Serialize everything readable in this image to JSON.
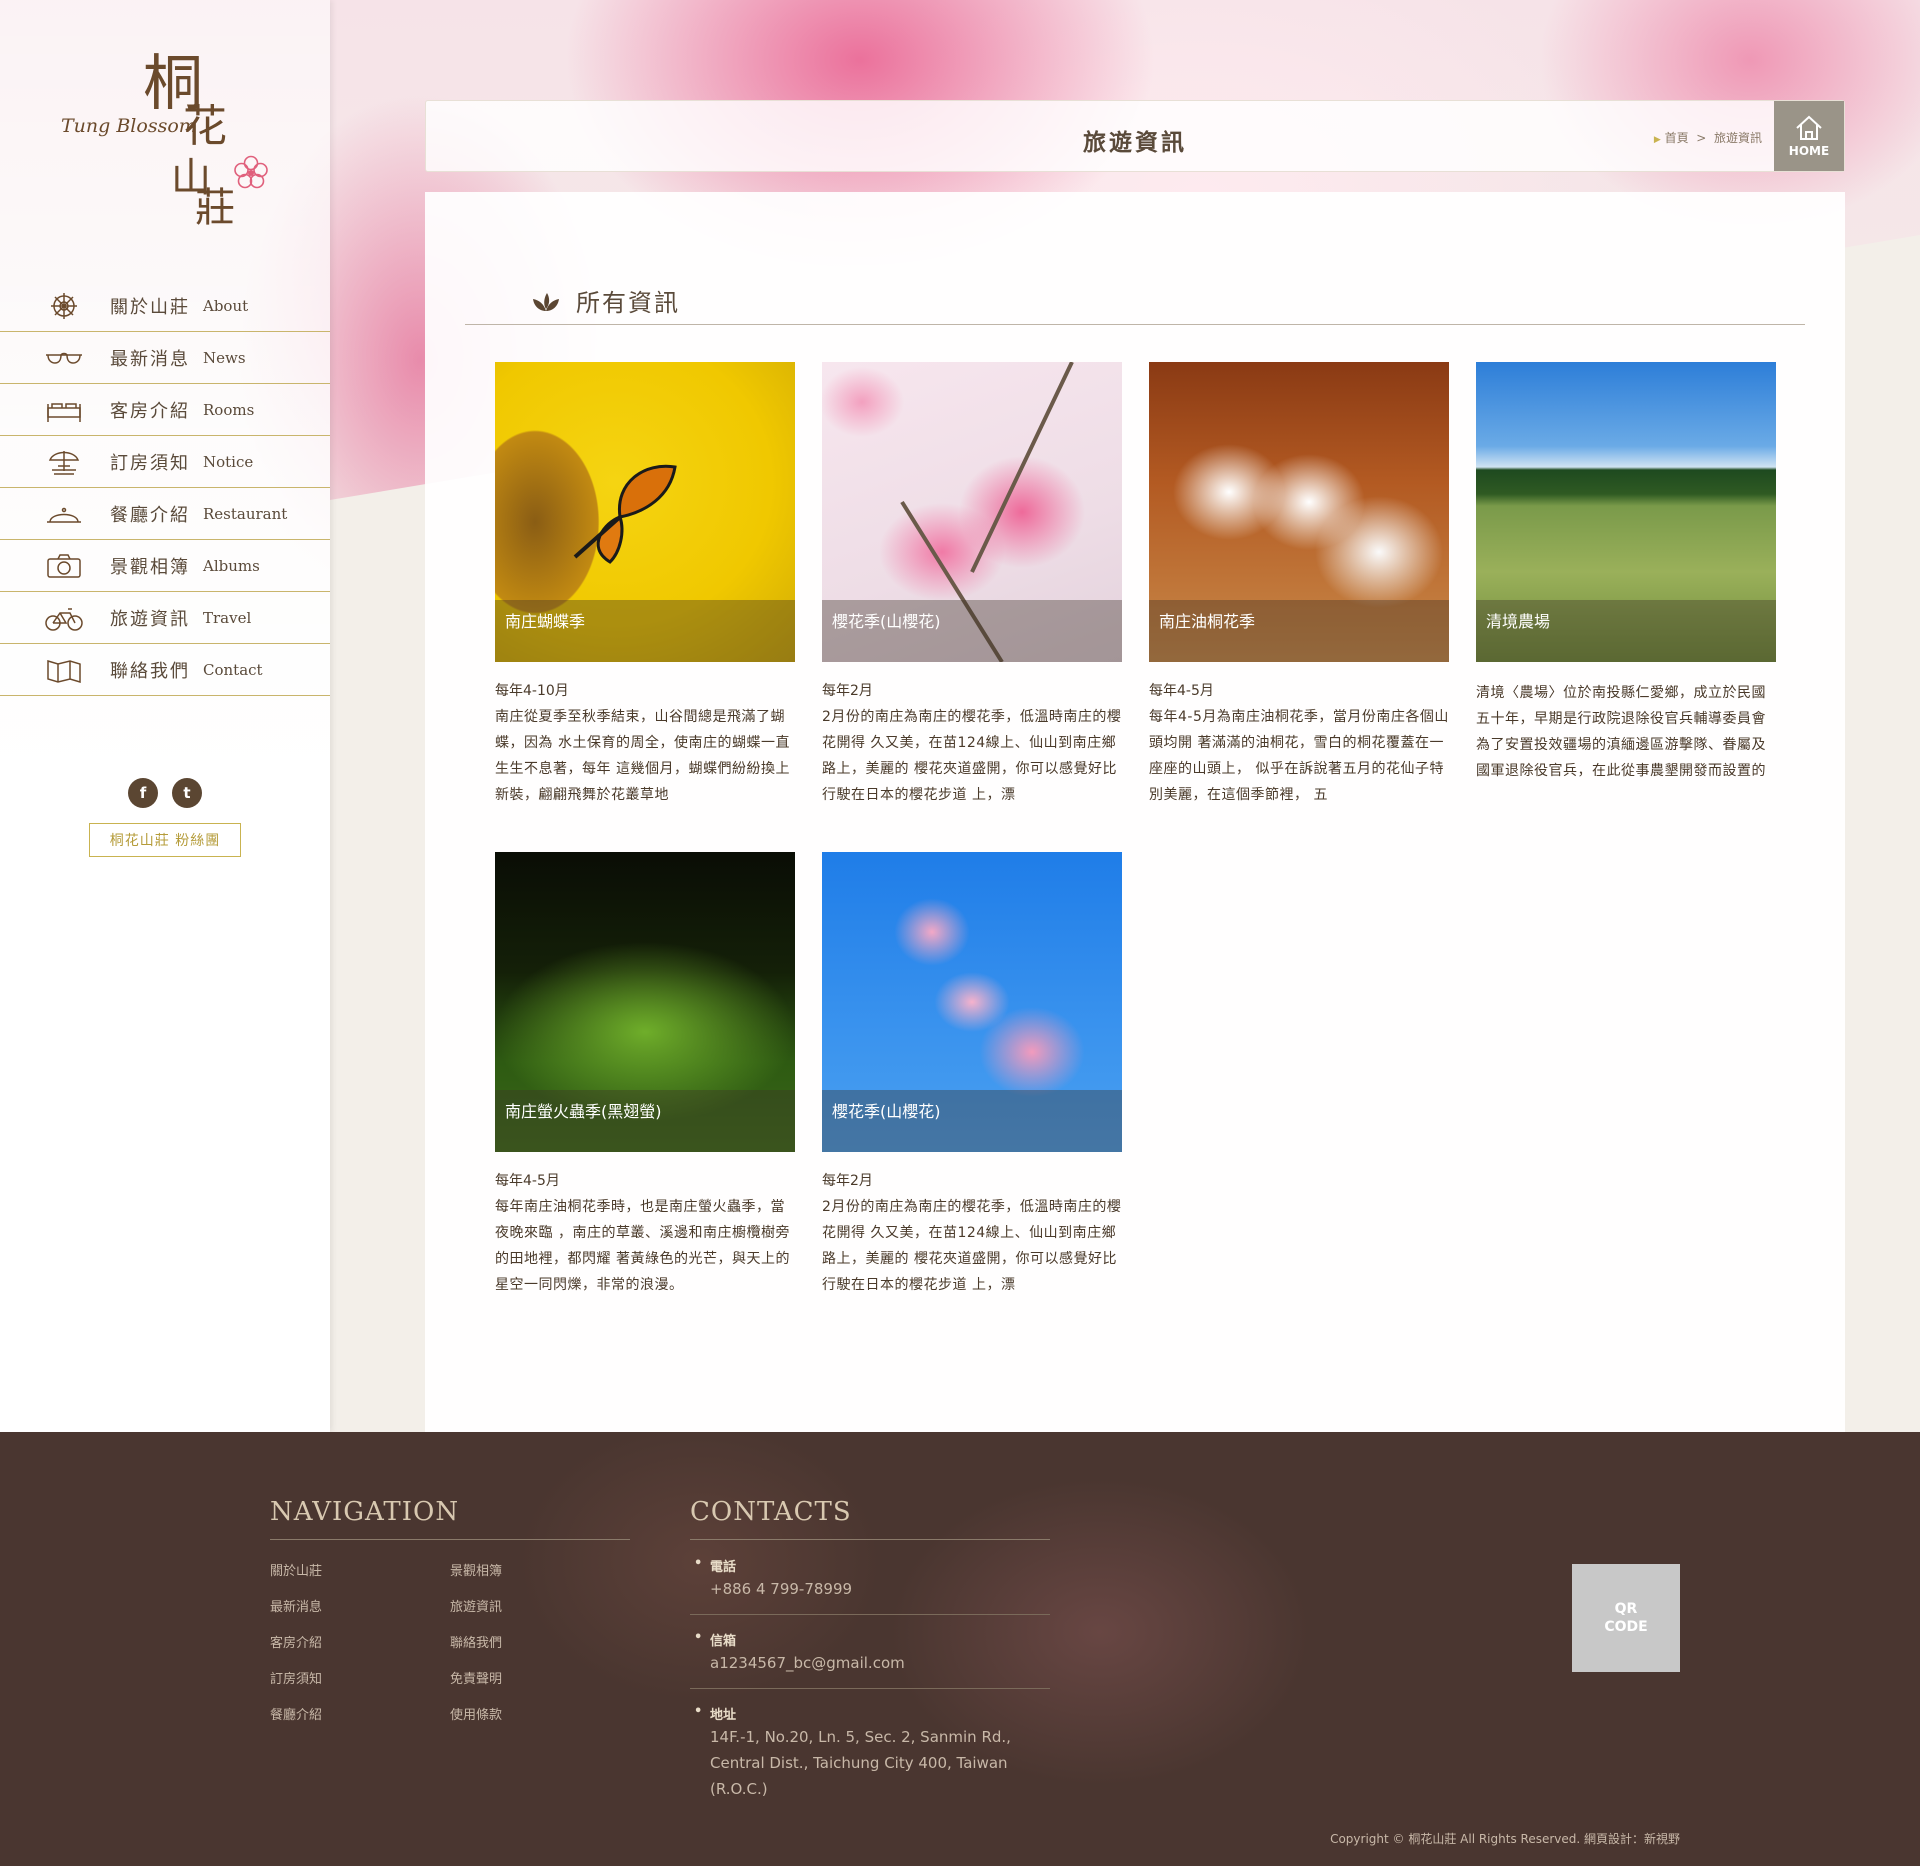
{
  "brand": {
    "name_zh_1": "桐",
    "name_zh_2": "花",
    "name_zh_3": "山",
    "name_zh_4": "莊",
    "name_en": "Tung Blossom"
  },
  "nav": {
    "items": [
      {
        "zh": "關於山莊",
        "en": "About",
        "icon": "dharma-wheel-icon"
      },
      {
        "zh": "最新消息",
        "en": "News",
        "icon": "glasses-icon"
      },
      {
        "zh": "客房介紹",
        "en": "Rooms",
        "icon": "bed-icon"
      },
      {
        "zh": "訂房須知",
        "en": "Notice",
        "icon": "parasol-icon"
      },
      {
        "zh": "餐廳介紹",
        "en": "Restaurant",
        "icon": "cloche-icon"
      },
      {
        "zh": "景觀相簿",
        "en": "Albums",
        "icon": "camera-icon"
      },
      {
        "zh": "旅遊資訊",
        "en": "Travel",
        "icon": "bicycle-icon"
      },
      {
        "zh": "聯絡我們",
        "en": "Contact",
        "icon": "map-icon"
      }
    ]
  },
  "social": {
    "facebook": "f",
    "twitter": "t",
    "fans_label": "桐花山莊 粉絲團"
  },
  "header": {
    "title": "旅遊資訊",
    "breadcrumb_home": "首頁",
    "breadcrumb_sep": ">",
    "breadcrumb_current": "旅遊資訊",
    "home_label": "HOME"
  },
  "section": {
    "title": "所有資訊"
  },
  "cards": [
    {
      "caption": "南庄蝴蝶季",
      "date": "每年4-10月",
      "desc": "南庄從夏季至秋季結束，山谷間總是飛滿了蝴蝶，因為 水土保育的周全，使南庄的蝴蝶一直生生不息著，每年 這幾個月，蝴蝶們紛紛換上新裝，翩翩飛舞於花叢草地"
    },
    {
      "caption": "櫻花季(山櫻花)",
      "date": "每年2月",
      "desc": "2月份的南庄為南庄的櫻花季，低溫時南庄的櫻花開得 久又美，在苗124線上、仙山到南庄鄉路上，美麗的 櫻花夾道盛開，你可以感覺好比行駛在日本的櫻花步道 上，漂"
    },
    {
      "caption": "南庄油桐花季",
      "date": "每年4-5月",
      "desc": "每年4-5月為南庄油桐花季，當月份南庄各個山頭均開 著滿滿的油桐花，雪白的桐花覆蓋在一座座的山頭上， 似乎在訴說著五月的花仙子特別美麗，在這個季節裡， 五"
    },
    {
      "caption": "清境農場",
      "date": "",
      "desc": "清境〈農場〉位於南投縣仁愛鄉，成立於民國五十年，早期是行政院退除役官兵輔導委員會為了安置投效疆場的滇緬邊區游擊隊、眷屬及國軍退除役官兵，在此從事農墾開發而設置的農場。"
    },
    {
      "caption": "南庄螢火蟲季(黑翅螢)",
      "date": "每年4-5月",
      "desc": "每年南庄油桐花季時，也是南庄螢火蟲季，當夜晚來臨 ，南庄的草叢、溪邊和南庄櫥欖樹旁的田地裡，都閃耀 著黃綠色的光芒，與天上的星空一同閃爍，非常的浪漫。"
    },
    {
      "caption": "櫻花季(山櫻花)",
      "date": "每年2月",
      "desc": "2月份的南庄為南庄的櫻花季，低溫時南庄的櫻花開得 久又美，在苗124線上、仙山到南庄鄉路上，美麗的 櫻花夾道盛開，你可以感覺好比行駛在日本的櫻花步道 上，漂"
    }
  ],
  "footer": {
    "nav_heading": "NAVIGATION",
    "contacts_heading": "CONTACTS",
    "links_col1": [
      "關於山莊",
      "最新消息",
      "客房介紹",
      "訂房須知",
      "餐廳介紹"
    ],
    "links_col2": [
      "景觀相簿",
      "旅遊資訊",
      "聯絡我們",
      "免責聲明",
      "使用條款"
    ],
    "phone_label": "電話",
    "phone": "+886 4 799-78999",
    "email_label": "信箱",
    "email": "a1234567_bc@gmail.com",
    "address_label": "地址",
    "address_1": "14F.-1, No.20, Ln. 5, Sec. 2, Sanmin Rd.,",
    "address_2": "Central Dist., Taichung City 400, Taiwan",
    "address_3": "(R.O.C.)",
    "qr_1": "QR",
    "qr_2": "CODE",
    "copyright": "Copyright © 桐花山莊 All Rights Reserved.    網頁設計：新視野"
  },
  "colors": {
    "accent_gold": "#c9b350",
    "text_brown": "#5a4a3a",
    "footer_bg": "#4a3630"
  }
}
